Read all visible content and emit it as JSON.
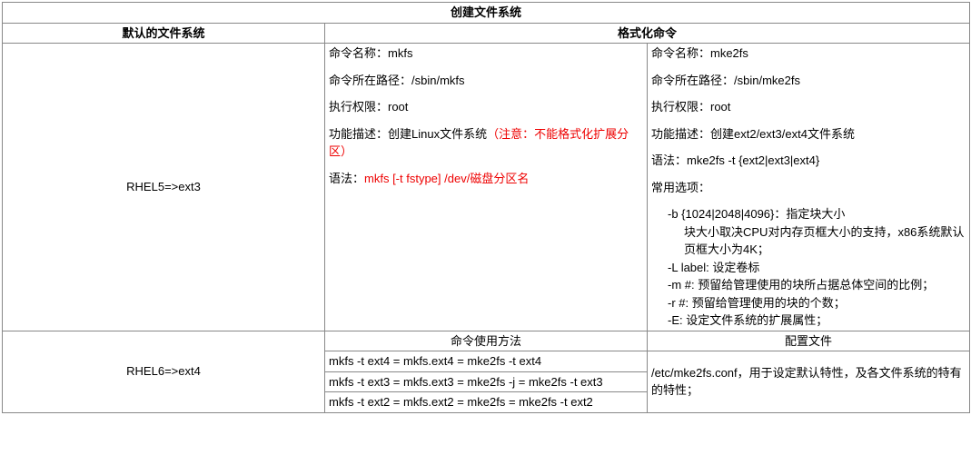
{
  "title": "创建文件系统",
  "header": {
    "col1": "默认的文件系统",
    "col2": "格式化命令"
  },
  "row1": {
    "fs": "RHEL5=>ext3",
    "mkfs": {
      "name_label": "命令名称：mkfs",
      "path_label": "命令所在路径：/sbin/mkfs",
      "perm_label": "执行权限：root",
      "desc_prefix": "功能描述：创建Linux文件系统",
      "desc_note": "（注意：不能格式化扩展分区）",
      "syntax_prefix": "语法：",
      "syntax_red": "mkfs [-t fstype] /dev/磁盘分区名"
    },
    "mke2fs": {
      "name_label": "命令名称：mke2fs",
      "path_label": "命令所在路径：/sbin/mke2fs",
      "perm_label": "执行权限：root",
      "desc_label": "功能描述：创建ext2/ext3/ext4文件系统",
      "syntax_label": "语法：mke2fs -t {ext2|ext3|ext4}",
      "opts_title": " 常用选项：",
      "opt_b": "-b {1024|2048|4096}：指定块大小",
      "opt_b2": "块大小取决CPU对内存页框大小的支持，x86系统默认页框大小为4K；",
      "opt_L": "-L label: 设定卷标",
      "opt_m": "-m #: 预留给管理使用的块所占据总体空间的比例；",
      "opt_r": "-r #: 预留给管理使用的块的个数；",
      "opt_E": "-E: 设定文件系统的扩展属性；"
    }
  },
  "row2": {
    "fs": "RHEL6=>ext4",
    "usage_header": "命令使用方法",
    "config_header": "配置文件",
    "usage_line1": "mkfs -t ext4 = mkfs.ext4 = mke2fs -t ext4",
    "usage_line2": "mkfs -t ext3 = mkfs.ext3 = mke2fs -j = mke2fs -t ext3",
    "usage_line3": "mkfs -t ext2 = mkfs.ext2 = mke2fs = mke2fs -t ext2",
    "config_text": "/etc/mke2fs.conf，用于设定默认特性，及各文件系统的特有的特性；"
  }
}
